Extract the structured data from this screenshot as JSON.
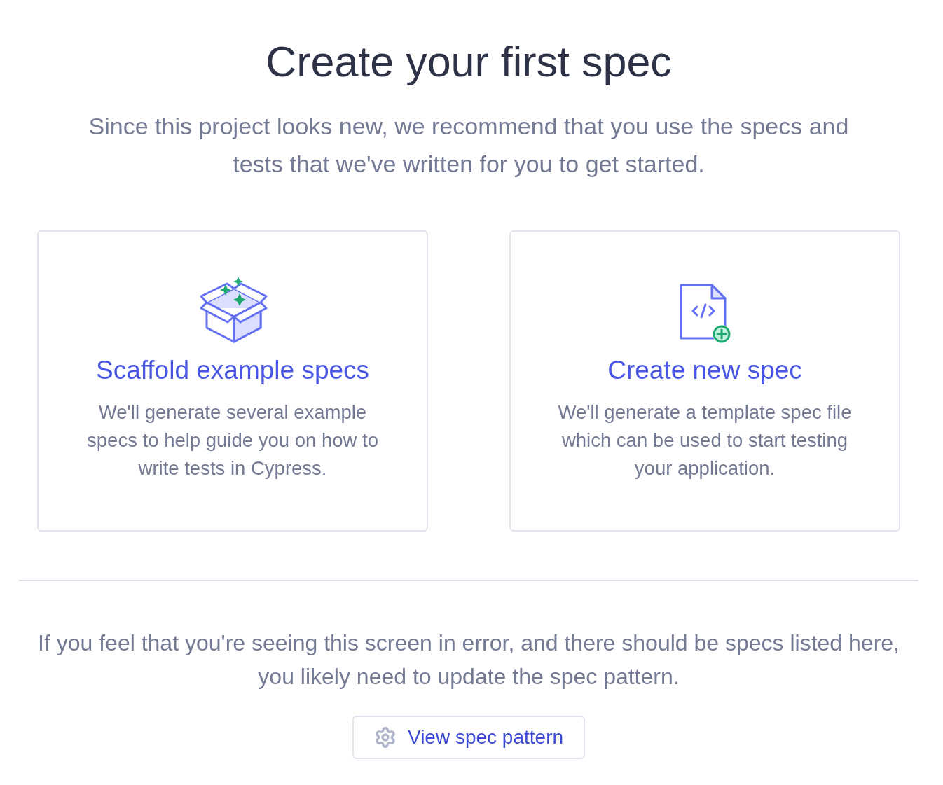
{
  "heading": "Create your first spec",
  "subheading": "Since this project looks new, we recommend that you use the specs and tests that we've written for you to get started.",
  "options": [
    {
      "kind": "scaffold",
      "title": "Scaffold example specs",
      "description": "We'll generate several example specs to help guide you on how to write tests in Cypress."
    },
    {
      "kind": "new-spec",
      "title": "Create new spec",
      "description": "We'll generate a template spec file which can be used to start testing your application."
    }
  ],
  "help_text": "If you feel that you're seeing this screen in error, and there should be specs listed here, you likely need to update the spec pattern.",
  "pattern_button": {
    "label": "View spec pattern"
  }
}
